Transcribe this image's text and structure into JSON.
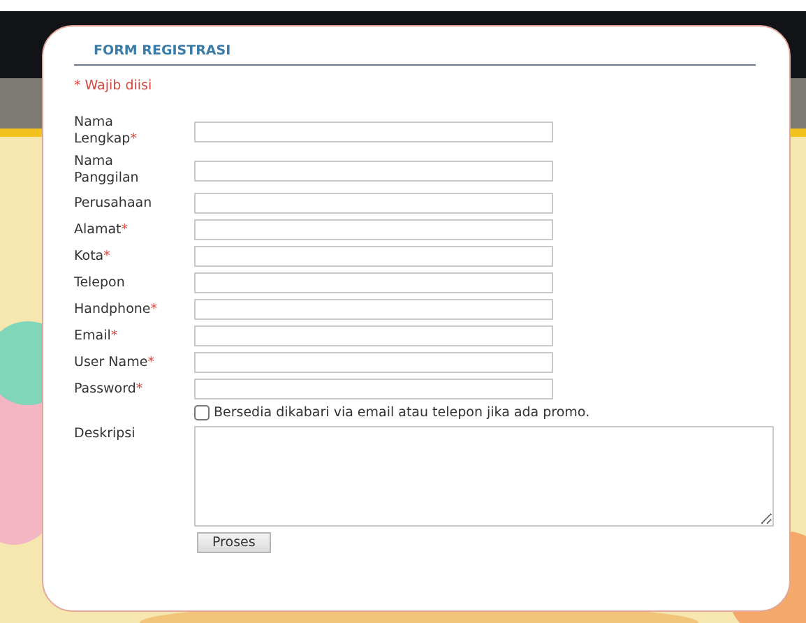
{
  "form": {
    "title": "FORM REGISTRASI",
    "note": "* Wajib diisi",
    "fields": [
      {
        "label": "Nama Lengkap",
        "mark": "*"
      },
      {
        "label": "Nama Panggilan"
      },
      {
        "label": "Perusahaan"
      },
      {
        "label": "Alamat",
        "mark": "*"
      },
      {
        "label": "Kota",
        "mark": "*"
      },
      {
        "label": "Telepon"
      },
      {
        "label": "Handphone",
        "mark": "*"
      },
      {
        "label": "Email",
        "mark": "*"
      },
      {
        "label": "User Name",
        "mark": "*"
      },
      {
        "label": "Password",
        "mark": "*"
      }
    ],
    "promo": {
      "label": "Bersedia dikabari via email atau telepon jika ada promo.",
      "checked": false
    },
    "description": {
      "label": "Deskripsi"
    },
    "submit": "Proses"
  }
}
